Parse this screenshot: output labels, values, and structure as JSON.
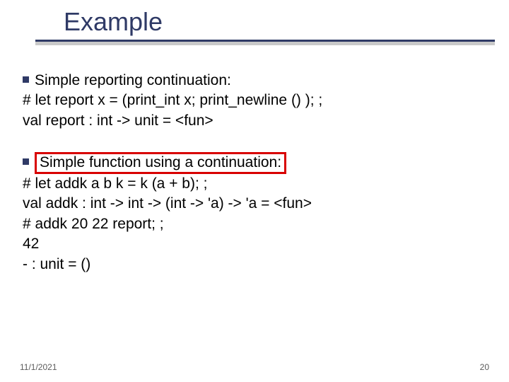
{
  "title": "Example",
  "block1": {
    "heading": "Simple reporting continuation:",
    "line1": "# let report x = (print_int x; print_newline () ); ;",
    "line2": "val report : int -> unit = <fun>"
  },
  "block2": {
    "heading": "Simple function using a continuation:",
    "line1": "# let addk a b k = k (a + b); ;",
    "line2": "val addk : int -> int -> (int -> 'a) -> 'a = <fun>",
    "line3": "# addk 20 22 report; ;",
    "line4": "42",
    "line5": "- : unit = ()"
  },
  "footer": {
    "date": "11/1/2021",
    "page": "20"
  }
}
